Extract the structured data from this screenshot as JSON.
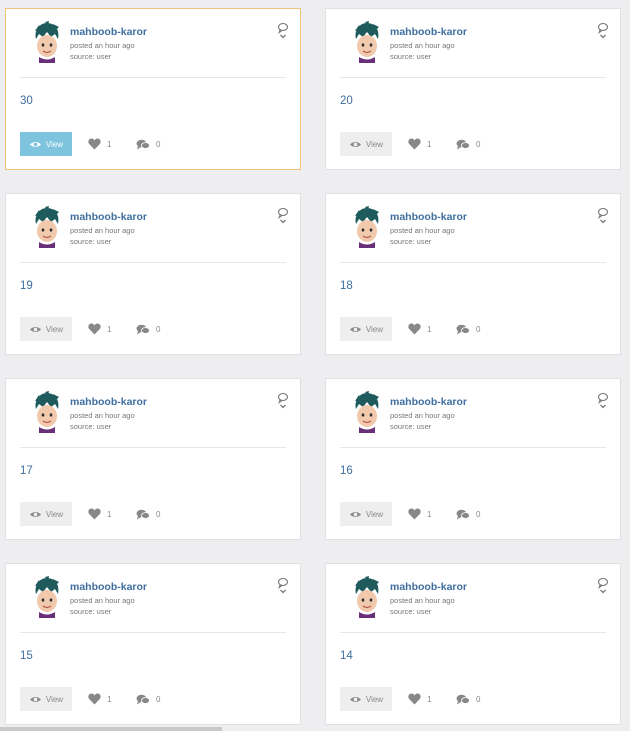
{
  "author": "mahboob-karor",
  "posted": "posted an hour ago",
  "source": "source: user",
  "view_label": "View",
  "colors": {
    "background": "#eeeef0",
    "author": "#3f6fa0",
    "title": "#3f6fa0",
    "view_active": "#7ec4df",
    "view_default": "#eeeeee",
    "active_border": "#f0c27b"
  },
  "cards": [
    {
      "title": "30",
      "likes": "1",
      "comments": "0",
      "active": true
    },
    {
      "title": "20",
      "likes": "1",
      "comments": "0",
      "active": false
    },
    {
      "title": "19",
      "likes": "1",
      "comments": "0",
      "active": false
    },
    {
      "title": "18",
      "likes": "1",
      "comments": "0",
      "active": false
    },
    {
      "title": "17",
      "likes": "1",
      "comments": "0",
      "active": false
    },
    {
      "title": "16",
      "likes": "1",
      "comments": "0",
      "active": false
    },
    {
      "title": "15",
      "likes": "1",
      "comments": "0",
      "active": false
    },
    {
      "title": "14",
      "likes": "1",
      "comments": "0",
      "active": false
    }
  ],
  "icons": {
    "avatar": "avatar",
    "menu": "comment-dropdown-icon",
    "view": "eye-icon",
    "like": "heart-icon",
    "comment": "comments-icon"
  }
}
